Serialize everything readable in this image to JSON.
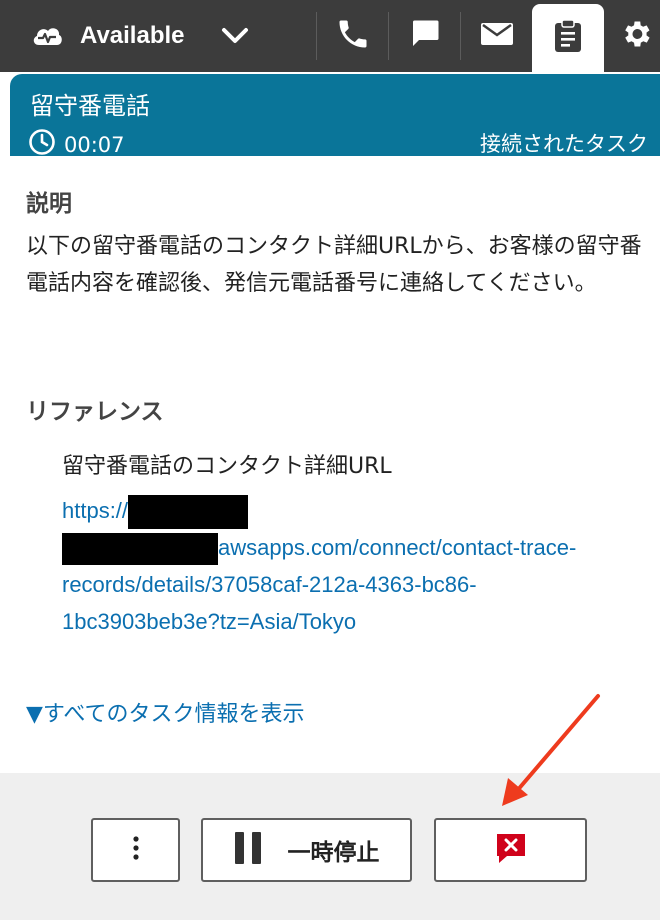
{
  "topbar": {
    "status_label": "Available",
    "icons": [
      "status-cloud-icon",
      "chevron-down-icon",
      "phone-icon",
      "chat-icon",
      "mail-icon",
      "task-clipboard-icon",
      "gear-icon"
    ]
  },
  "contact": {
    "title": "留守番電話",
    "timer": "00:07",
    "state": "接続されたタスク",
    "accent_color": "#0a7599"
  },
  "description": {
    "label": "説明",
    "text": "以下の留守番電話のコンタクト詳細URLから、お客様の留守番電話内容を確認後、発信元電話番号に連絡してください。"
  },
  "references": {
    "label": "リファレンス",
    "items": [
      {
        "name": "留守番電話のコンタクト詳細URL",
        "url_prefix": "https://",
        "url_suffix": "awsapps.com/connect/contact-trace-records/details/37058caf-212a-4363-bc86-1bc3903beb3e?tz=Asia/Tokyo"
      }
    ]
  },
  "show_all_link": "▼すべてのタスク情報を表示",
  "actions": {
    "more_icon": "more-vertical-icon",
    "pause_label": "一時停止",
    "pause_icon": "pause-icon",
    "end_icon": "end-task-icon",
    "end_color": "#d0021b"
  },
  "annotation": {
    "arrow_color": "#ee3b1e"
  }
}
